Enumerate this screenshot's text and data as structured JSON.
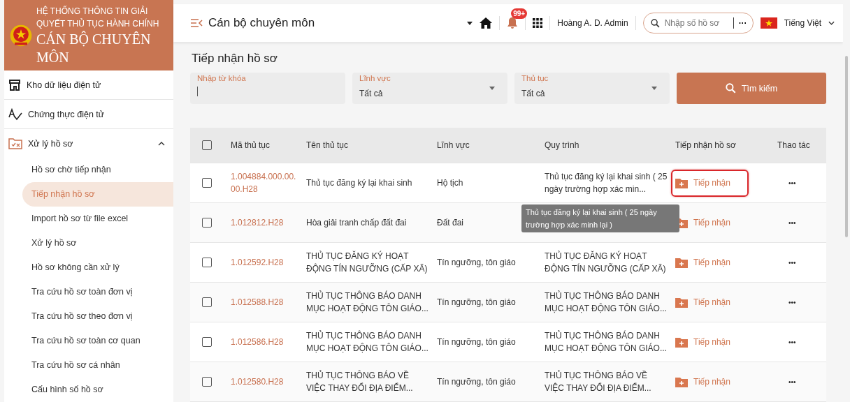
{
  "brand": {
    "subtitle": "HỆ THỐNG THÔNG TIN GIẢI QUYẾT THỦ TỤC HÀNH CHÍNH",
    "title": "CÁN BỘ CHUYÊN MÔN"
  },
  "sidebar": {
    "items": [
      {
        "label": "Kho dữ liệu điện tử",
        "kind": "store",
        "expanded": false
      },
      {
        "label": "Chứng thực điện tử",
        "kind": "sign",
        "expanded": false
      },
      {
        "label": "Xử lý hồ sơ",
        "kind": "folder",
        "expanded": true,
        "children": [
          {
            "label": "Hồ sơ chờ tiếp nhận",
            "selected": false
          },
          {
            "label": "Tiếp nhận hồ sơ",
            "selected": true
          },
          {
            "label": "Import hồ sơ từ file excel",
            "selected": false
          },
          {
            "label": "Xử lý hồ sơ",
            "selected": false
          },
          {
            "label": "Hồ sơ không cần xử lý",
            "selected": false
          },
          {
            "label": "Tra cứu hồ sơ toàn đơn vị",
            "selected": false
          },
          {
            "label": "Tra cứu hồ sơ theo đơn vị",
            "selected": false
          },
          {
            "label": "Tra cứu hồ sơ toàn cơ quan",
            "selected": false
          },
          {
            "label": "Tra cứu hồ sơ cá nhân",
            "selected": false
          },
          {
            "label": "Cấu hình số hồ sơ",
            "selected": false
          }
        ]
      }
    ]
  },
  "topbar": {
    "title": "Cán bộ chuyên môn",
    "notification_badge": "99+",
    "user": "Hoàng A. D. Admin",
    "search": {
      "placeholder": "Nhập số hồ sơ"
    },
    "more": "···",
    "language": "Tiếng Việt"
  },
  "page_title": "Tiếp nhận hồ sơ",
  "filters": [
    {
      "kind": "text",
      "label": "Nhập từ khóa"
    },
    {
      "kind": "select",
      "label": "Lĩnh vực",
      "value": "Tất cả"
    },
    {
      "kind": "select",
      "label": "Thủ tục",
      "value": "Tất cả"
    }
  ],
  "search_button": "Tìm kiếm",
  "table": {
    "select_all_checked": false,
    "columns": [
      "Mã thủ tục",
      "Tên thủ tục",
      "Lĩnh vực",
      "Quy trình",
      "Tiếp nhận hồ sơ",
      "Thao tác"
    ],
    "rows": [
      {
        "checked": false,
        "code": "1.004884.000.00.00.H28",
        "name": "Thủ tục đăng ký lại khai sinh",
        "field": "Hộ tịch",
        "process": "Thủ tục đăng ký lại khai sinh ( 25 ngày trường hợp xác min...",
        "action": "Tiếp nhận",
        "highlighted": true,
        "more": "•••"
      },
      {
        "checked": false,
        "code": "1.012812.H28",
        "name": "Hòa giải tranh chấp đất đai",
        "field": "Đất đai",
        "action": "Tiếp nhận",
        "highlighted": false,
        "more": "•••"
      },
      {
        "checked": false,
        "code": "1.012592.H28",
        "name": "THỦ TỤC ĐĂNG KÝ HOẠT ĐỘNG TÍN NGƯỠNG (CẤP XÃ)",
        "field": "Tín ngưỡng, tôn giáo",
        "process": "THỦ TỤC ĐĂNG KÝ HOẠT ĐỘNG TÍN NGƯỠNG (CẤP XÃ)",
        "action": "Tiếp nhận",
        "highlighted": false,
        "more": "•••"
      },
      {
        "checked": false,
        "code": "1.012588.H28",
        "name": "THỦ TỤC THÔNG BÁO DANH MỤC HOẠT ĐỘNG TÔN GIÁO...",
        "field": "Tín ngưỡng, tôn giáo",
        "process": "THỦ TỤC THÔNG BÁO DANH MỤC HOẠT ĐỘNG TÔN GIÁO...",
        "action": "Tiếp nhận",
        "highlighted": false,
        "more": "•••"
      },
      {
        "checked": false,
        "code": "1.012586.H28",
        "name": "THỦ TỤC THÔNG BÁO DANH MỤC HOẠT ĐỘNG TÔN GIÁO...",
        "field": "Tín ngưỡng, tôn giáo",
        "process": "THỦ TỤC THÔNG BÁO DANH MỤC HOẠT ĐỘNG TÔN GIÁO...",
        "action": "Tiếp nhận",
        "highlighted": false,
        "more": "•••"
      },
      {
        "checked": false,
        "code": "1.012580.H28",
        "name": "THỦ TỤC THÔNG BÁO VỀ VIỆC THAY ĐỔI ĐỊA ĐIỂM...",
        "field": "Tín ngưỡng, tôn giáo",
        "process": "THỦ TỤC THÔNG BÁO VỀ VIỆC THAY ĐỔI ĐỊA ĐIỂM...",
        "action": "Tiếp nhận",
        "highlighted": false,
        "more": "•••"
      }
    ]
  },
  "tooltip": "Thủ tục đăng ký lại khai sinh ( 25 ngày trường hợp xác minh lại )"
}
